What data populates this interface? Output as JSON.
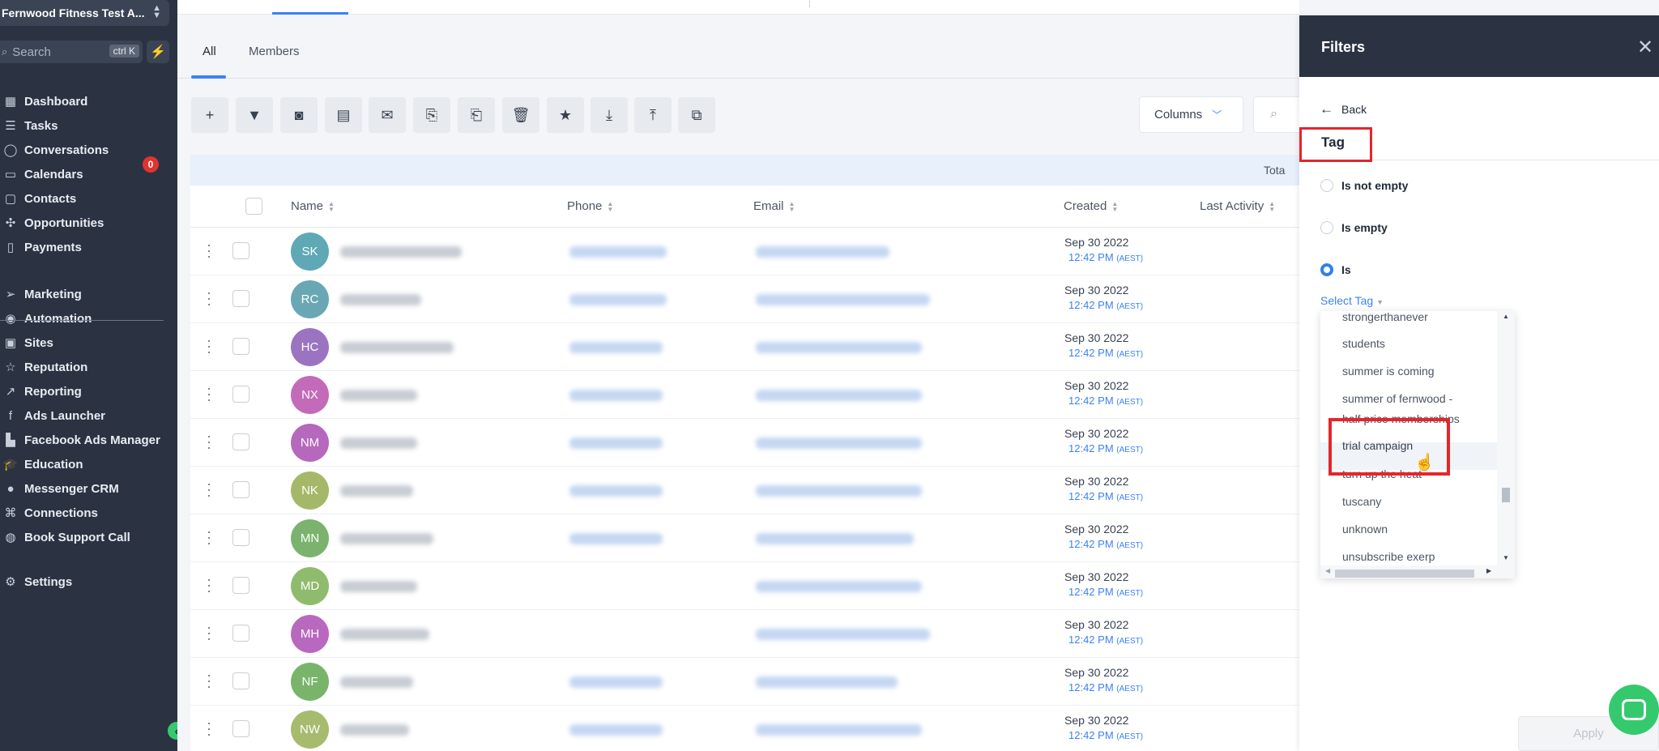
{
  "sidebar": {
    "account_name": "Fernwood Fitness Test A...",
    "search_placeholder": "Search",
    "search_shortcut": "ctrl K",
    "conversations_count": "0",
    "items": [
      {
        "label": "Dashboard",
        "icon": "dashboard-icon",
        "glyph": "▦"
      },
      {
        "label": "Tasks",
        "icon": "tasks-icon",
        "glyph": "☰"
      },
      {
        "label": "Conversations",
        "icon": "chat-bubble-icon",
        "glyph": "◯"
      },
      {
        "label": "Calendars",
        "icon": "calendar-icon",
        "glyph": "▭"
      },
      {
        "label": "Contacts",
        "icon": "contacts-icon",
        "glyph": "▢"
      },
      {
        "label": "Opportunities",
        "icon": "opportunities-icon",
        "glyph": "✣"
      },
      {
        "label": "Payments",
        "icon": "payments-icon",
        "glyph": "▯"
      },
      {
        "label": "Marketing",
        "icon": "paper-plane-icon",
        "glyph": "➢"
      },
      {
        "label": "Automation",
        "icon": "automation-icon",
        "glyph": "◉"
      },
      {
        "label": "Sites",
        "icon": "sites-icon",
        "glyph": "▣"
      },
      {
        "label": "Reputation",
        "icon": "star-outline-icon",
        "glyph": "☆"
      },
      {
        "label": "Reporting",
        "icon": "trend-icon",
        "glyph": "↗"
      },
      {
        "label": "Ads Launcher",
        "icon": "facebook-icon",
        "glyph": "f"
      },
      {
        "label": "Facebook Ads Manager",
        "icon": "bar-chart-icon",
        "glyph": "▙"
      },
      {
        "label": "Education",
        "icon": "graduation-cap-icon",
        "glyph": "🎓"
      },
      {
        "label": "Messenger CRM",
        "icon": "messenger-icon",
        "glyph": "●"
      },
      {
        "label": "Connections",
        "icon": "network-icon",
        "glyph": "⌘"
      },
      {
        "label": "Book Support Call",
        "icon": "headset-icon",
        "glyph": "◍"
      },
      {
        "label": "Settings",
        "icon": "gear-icon",
        "glyph": "⚙"
      }
    ]
  },
  "main": {
    "tabs": [
      "All",
      "Members"
    ],
    "columns_label": "Columns",
    "total_label": "Tota",
    "headers": {
      "name": "Name",
      "phone": "Phone",
      "email": "Email",
      "created": "Created",
      "last_activity": "Last Activity"
    },
    "rows": [
      {
        "initials": "SK",
        "color": "#5fa8b5",
        "date": "Sep 30 2022",
        "time": "12:42 PM",
        "tz": "(AEST)"
      },
      {
        "initials": "RC",
        "color": "#6aa7b4",
        "date": "Sep 30 2022",
        "time": "12:42 PM",
        "tz": "(AEST)"
      },
      {
        "initials": "HC",
        "color": "#9b74c1",
        "date": "Sep 30 2022",
        "time": "12:42 PM",
        "tz": "(AEST)"
      },
      {
        "initials": "NX",
        "color": "#c36ab8",
        "date": "Sep 30 2022",
        "time": "12:42 PM",
        "tz": "(AEST)"
      },
      {
        "initials": "NM",
        "color": "#b668bd",
        "date": "Sep 30 2022",
        "time": "12:42 PM",
        "tz": "(AEST)"
      },
      {
        "initials": "NK",
        "color": "#a5b86a",
        "date": "Sep 30 2022",
        "time": "12:42 PM",
        "tz": "(AEST)"
      },
      {
        "initials": "MN",
        "color": "#7bb36e",
        "date": "Sep 30 2022",
        "time": "12:42 PM",
        "tz": "(AEST)"
      },
      {
        "initials": "MD",
        "color": "#8fbb6d",
        "date": "Sep 30 2022",
        "time": "12:42 PM",
        "tz": "(AEST)"
      },
      {
        "initials": "MH",
        "color": "#b968bf",
        "date": "Sep 30 2022",
        "time": "12:42 PM",
        "tz": "(AEST)"
      },
      {
        "initials": "NF",
        "color": "#79b46b",
        "date": "Sep 30 2022",
        "time": "12:42 PM",
        "tz": "(AEST)"
      },
      {
        "initials": "NW",
        "color": "#a6bb6e",
        "date": "Sep 30 2022",
        "time": "12:42 PM",
        "tz": "(AEST)"
      }
    ]
  },
  "filters": {
    "title": "Filters",
    "back_label": "Back",
    "field_label": "Tag",
    "options": [
      {
        "label": "Is not empty",
        "selected": false
      },
      {
        "label": "Is empty",
        "selected": false
      },
      {
        "label": "Is",
        "selected": true
      }
    ],
    "select_label": "Select Tag",
    "tag_options": [
      "strongerthanever",
      "students",
      "summer is coming",
      "summer of fernwood -",
      "half price memberships",
      "trial campaign",
      "turn up the heat",
      "tuscany",
      "unknown",
      "unsubscribe exerp"
    ],
    "hovered_option": "trial campaign",
    "apply_label": "Apply"
  }
}
